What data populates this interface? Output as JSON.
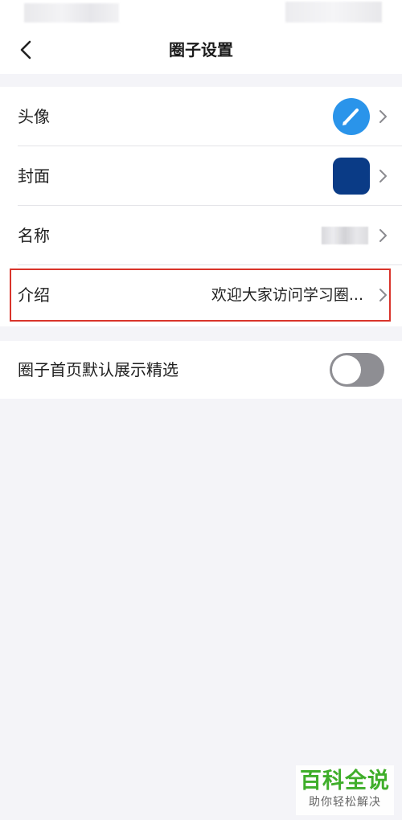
{
  "header": {
    "title": "圈子设置",
    "back_icon": "chevron-left-icon"
  },
  "settings": {
    "avatar_label": "头像",
    "cover_label": "封面",
    "name_label": "名称",
    "intro_label": "介绍",
    "intro_value": "欢迎大家访问学习圈...",
    "featured_label": "圈子首页默认展示精选",
    "featured_enabled": false
  },
  "watermark": {
    "main": "百科全说",
    "sub": "助你轻松解决"
  },
  "colors": {
    "accent_blue": "#2a94ea",
    "cover_navy": "#0a3b86",
    "highlight_red": "#d9342b",
    "toggle_off": "#8e8e93",
    "watermark_green": "#3fae2a"
  }
}
